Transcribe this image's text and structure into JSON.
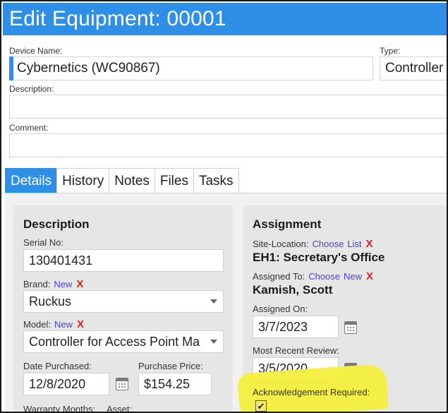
{
  "header": {
    "title": "Edit Equipment: 00001"
  },
  "form": {
    "device_name_label": "Device Name:",
    "device_name_value": "Cybernetics (WC90867)",
    "type_label": "Type:",
    "type_value": "Controller",
    "description_label": "Description:",
    "description_value": "",
    "comment_label": "Comment:",
    "comment_value": ""
  },
  "tabs": [
    {
      "label": "Details",
      "active": true
    },
    {
      "label": "History",
      "active": false
    },
    {
      "label": "Notes",
      "active": false
    },
    {
      "label": "Files",
      "active": false
    },
    {
      "label": "Tasks",
      "active": false
    }
  ],
  "details": {
    "title": "Description",
    "serial_label": "Serial No:",
    "serial_value": "130401431",
    "brand_label": "Brand:",
    "brand_new": "New",
    "brand_value": "Ruckus",
    "model_label": "Model:",
    "model_new": "New",
    "model_value": "Controller for Access Point Ma",
    "date_purchased_label": "Date Purchased:",
    "date_purchased_value": "12/8/2020",
    "purchase_price_label": "Purchase Price:",
    "purchase_price_value": "$154.25",
    "warranty_label": "Warranty Months:",
    "asset_label": "Asset:"
  },
  "assignment": {
    "title": "Assignment",
    "site_label": "Site-Location:",
    "site_choose": "Choose",
    "site_list": "List",
    "site_value": "EH1: Secretary's Office",
    "assigned_to_label": "Assigned To:",
    "assigned_choose": "Choose",
    "assigned_new": "New",
    "assigned_to_value": "Kamish, Scott",
    "assigned_on_label": "Assigned On:",
    "assigned_on_value": "3/7/2023",
    "review_label": "Most Recent Review:",
    "review_value": "3/5/2020",
    "ack_label": "Acknowledgement Required:",
    "ack_checked": true,
    "ack_mark": "✔"
  },
  "symbols": {
    "remove": "X"
  },
  "colors": {
    "accent": "#2f8fe7",
    "link": "#4a3fd6",
    "remove": "#e02020",
    "highlight": "#f4f03a"
  }
}
